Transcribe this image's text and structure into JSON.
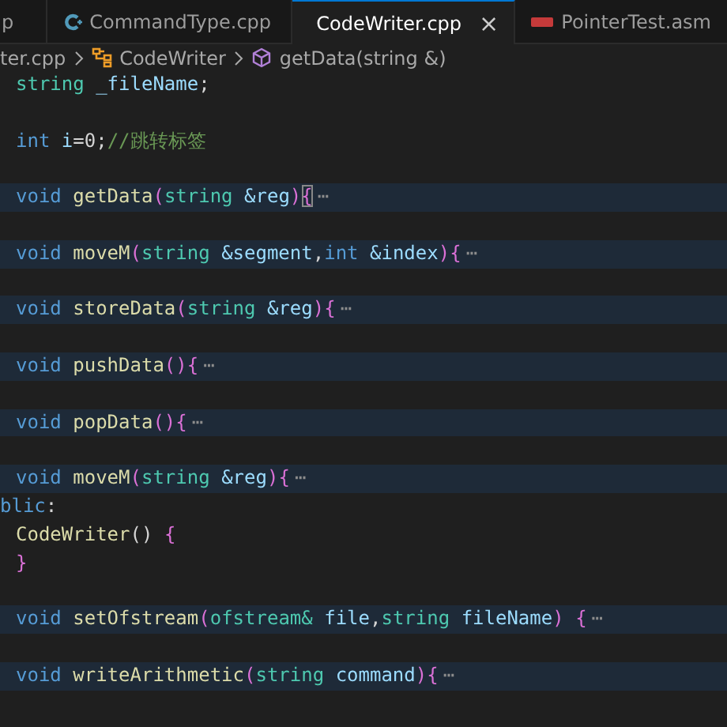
{
  "tabs": [
    {
      "label": "p",
      "kind": "plain",
      "selected": false
    },
    {
      "label": "CommandType.cpp",
      "kind": "cpp",
      "selected": false
    },
    {
      "label": "CodeWriter.cpp",
      "kind": "cpp",
      "selected": true,
      "close": "×"
    },
    {
      "label": "PointerTest.asm",
      "kind": "asm",
      "selected": false
    }
  ],
  "breadcrumb": [
    {
      "label": "ter.cpp",
      "kind": "file"
    },
    {
      "label": "CodeWriter",
      "kind": "class"
    },
    {
      "label": "getData(string &)",
      "kind": "method"
    }
  ],
  "lines": [
    {
      "kind": "member",
      "folded": false,
      "tokens": [
        {
          "text": "string ",
          "kind": "type"
        },
        {
          "text": "_fileName",
          "kind": "param"
        },
        {
          "text": ";",
          "kind": "plain"
        }
      ]
    },
    {
      "kind": "empty",
      "folded": false
    },
    {
      "kind": "member",
      "folded": false,
      "tokens": [
        {
          "text": "int ",
          "kind": "keyword"
        },
        {
          "text": "i",
          "kind": "param"
        },
        {
          "text": "=0;",
          "kind": "plain"
        },
        {
          "text": "//跳转标签",
          "kind": "comment"
        }
      ]
    },
    {
      "kind": "empty",
      "folded": false
    },
    {
      "kind": "member",
      "folded": true,
      "tokens": [
        {
          "text": "void ",
          "kind": "keyword"
        },
        {
          "text": "getData",
          "kind": "func"
        },
        {
          "text": "(",
          "kind": "bracket"
        },
        {
          "text": "string ",
          "kind": "type"
        },
        {
          "text": "&reg",
          "kind": "param"
        },
        {
          "text": ")",
          "kind": "bracket"
        },
        {
          "text": "{",
          "kind": "matched"
        },
        {
          "text": "⋯",
          "kind": "fold"
        }
      ]
    },
    {
      "kind": "empty",
      "folded": false
    },
    {
      "kind": "member",
      "folded": true,
      "tokens": [
        {
          "text": "void ",
          "kind": "keyword"
        },
        {
          "text": "moveM",
          "kind": "func"
        },
        {
          "text": "(",
          "kind": "bracket"
        },
        {
          "text": "string ",
          "kind": "type"
        },
        {
          "text": "&segment",
          "kind": "param"
        },
        {
          "text": ",",
          "kind": "plain"
        },
        {
          "text": "int ",
          "kind": "keyword"
        },
        {
          "text": "&index",
          "kind": "param"
        },
        {
          "text": ")",
          "kind": "bracket"
        },
        {
          "text": "{",
          "kind": "bracket"
        },
        {
          "text": "⋯",
          "kind": "fold"
        }
      ]
    },
    {
      "kind": "empty",
      "folded": false
    },
    {
      "kind": "member",
      "folded": true,
      "tokens": [
        {
          "text": "void ",
          "kind": "keyword"
        },
        {
          "text": "storeData",
          "kind": "func"
        },
        {
          "text": "(",
          "kind": "bracket"
        },
        {
          "text": "string ",
          "kind": "type"
        },
        {
          "text": "&reg",
          "kind": "param"
        },
        {
          "text": ")",
          "kind": "bracket"
        },
        {
          "text": "{",
          "kind": "bracket"
        },
        {
          "text": "⋯",
          "kind": "fold"
        }
      ]
    },
    {
      "kind": "empty",
      "folded": false
    },
    {
      "kind": "member",
      "folded": true,
      "tokens": [
        {
          "text": "void ",
          "kind": "keyword"
        },
        {
          "text": "pushData",
          "kind": "func"
        },
        {
          "text": "()",
          "kind": "bracket"
        },
        {
          "text": "{",
          "kind": "bracket"
        },
        {
          "text": "⋯",
          "kind": "fold"
        }
      ]
    },
    {
      "kind": "empty",
      "folded": false
    },
    {
      "kind": "member",
      "folded": true,
      "tokens": [
        {
          "text": "void ",
          "kind": "keyword"
        },
        {
          "text": "popData",
          "kind": "func"
        },
        {
          "text": "()",
          "kind": "bracket"
        },
        {
          "text": "{",
          "kind": "bracket"
        },
        {
          "text": "⋯",
          "kind": "fold"
        }
      ]
    },
    {
      "kind": "empty",
      "folded": false
    },
    {
      "kind": "member",
      "folded": true,
      "tokens": [
        {
          "text": "void ",
          "kind": "keyword"
        },
        {
          "text": "moveM",
          "kind": "func"
        },
        {
          "text": "(",
          "kind": "bracket"
        },
        {
          "text": "string ",
          "kind": "type"
        },
        {
          "text": "&reg",
          "kind": "param"
        },
        {
          "text": ")",
          "kind": "bracket"
        },
        {
          "text": "{",
          "kind": "bracket"
        },
        {
          "text": "⋯",
          "kind": "fold"
        }
      ]
    },
    {
      "kind": "label",
      "folded": false,
      "tokens": [
        {
          "text": "blic",
          "kind": "keyword"
        },
        {
          "text": ":",
          "kind": "plain"
        }
      ]
    },
    {
      "kind": "member",
      "folded": false,
      "tokens": [
        {
          "text": "CodeWriter",
          "kind": "func"
        },
        {
          "text": "() ",
          "kind": "plain"
        },
        {
          "text": "{",
          "kind": "bracket"
        }
      ]
    },
    {
      "kind": "member",
      "folded": false,
      "tokens": [
        {
          "text": "}",
          "kind": "bracket"
        }
      ]
    },
    {
      "kind": "empty",
      "folded": false
    },
    {
      "kind": "member",
      "folded": true,
      "tokens": [
        {
          "text": "void ",
          "kind": "keyword"
        },
        {
          "text": "setOfstream",
          "kind": "func"
        },
        {
          "text": "(",
          "kind": "bracket"
        },
        {
          "text": "ofstream& ",
          "kind": "type"
        },
        {
          "text": "file",
          "kind": "param"
        },
        {
          "text": ",",
          "kind": "plain"
        },
        {
          "text": "string ",
          "kind": "type"
        },
        {
          "text": "fileName",
          "kind": "param"
        },
        {
          "text": ") ",
          "kind": "bracket"
        },
        {
          "text": "{",
          "kind": "bracket"
        },
        {
          "text": "⋯",
          "kind": "fold"
        }
      ]
    },
    {
      "kind": "empty",
      "folded": false
    },
    {
      "kind": "member",
      "folded": true,
      "tokens": [
        {
          "text": "void ",
          "kind": "keyword"
        },
        {
          "text": "writeArithmetic",
          "kind": "func"
        },
        {
          "text": "(",
          "kind": "bracket"
        },
        {
          "text": "string ",
          "kind": "type"
        },
        {
          "text": "command",
          "kind": "param"
        },
        {
          "text": ")",
          "kind": "bracket"
        },
        {
          "text": "{",
          "kind": "bracket"
        },
        {
          "text": "⋯",
          "kind": "fold"
        }
      ]
    },
    {
      "kind": "empty",
      "folded": false
    }
  ]
}
